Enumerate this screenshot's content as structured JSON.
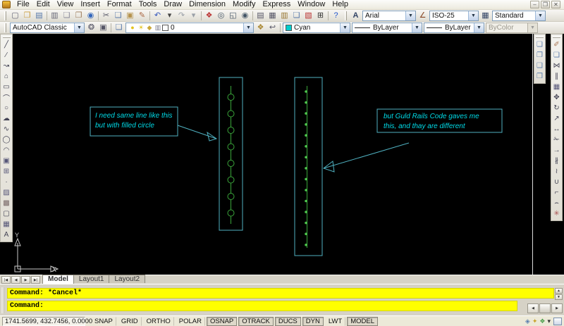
{
  "menu": {
    "items": [
      {
        "n": "menu-file",
        "t": "File"
      },
      {
        "n": "menu-edit",
        "t": "Edit"
      },
      {
        "n": "menu-view",
        "t": "View"
      },
      {
        "n": "menu-insert",
        "t": "Insert"
      },
      {
        "n": "menu-format",
        "t": "Format"
      },
      {
        "n": "menu-tools",
        "t": "Tools"
      },
      {
        "n": "menu-draw",
        "t": "Draw"
      },
      {
        "n": "menu-dimension",
        "t": "Dimension"
      },
      {
        "n": "menu-modify",
        "t": "Modify"
      },
      {
        "n": "menu-express",
        "t": "Express"
      },
      {
        "n": "menu-window",
        "t": "Window"
      },
      {
        "n": "menu-help",
        "t": "Help"
      }
    ]
  },
  "window_controls": [
    {
      "n": "minimize-button",
      "t": "–"
    },
    {
      "n": "restore-button",
      "t": "❐"
    },
    {
      "n": "close-button",
      "t": "✕"
    }
  ],
  "standard_toolbar": {
    "icons": [
      {
        "n": "new-icon",
        "t": "▢",
        "c": "#667"
      },
      {
        "n": "open-icon",
        "t": "❒",
        "c": "#c89a3a"
      },
      {
        "n": "save-icon",
        "t": "▤",
        "c": "#5577aa"
      },
      {
        "sep": true
      },
      {
        "n": "plot-icon",
        "t": "▥",
        "c": "#667"
      },
      {
        "n": "plot-preview-icon",
        "t": "❏",
        "c": "#889"
      },
      {
        "n": "publish-icon",
        "t": "❐",
        "c": "#997755"
      },
      {
        "n": "web-icon",
        "t": "◉",
        "c": "#3366bb"
      },
      {
        "sep": true
      },
      {
        "n": "cut-icon",
        "t": "✂",
        "c": "#556"
      },
      {
        "n": "copy-icon",
        "t": "❑",
        "c": "#5577aa"
      },
      {
        "n": "paste-icon",
        "t": "▣",
        "c": "#b5924c"
      },
      {
        "n": "match-properties-icon",
        "t": "✎",
        "c": "#aa6644"
      },
      {
        "sep": true
      },
      {
        "n": "undo-icon",
        "t": "↶",
        "c": "#3355bb"
      },
      {
        "n": "undo-dropdown-arrow",
        "t": "▾",
        "c": "#444"
      },
      {
        "n": "redo-icon",
        "t": "↷",
        "c": "#9aa0a8"
      },
      {
        "n": "redo-dropdown-arrow",
        "t": "▾",
        "c": "#9aa0a8"
      },
      {
        "sep": true
      },
      {
        "n": "pan-icon",
        "t": "❖",
        "c": "#bb3333"
      },
      {
        "n": "zoom-realtime-icon",
        "t": "◎",
        "c": "#445566"
      },
      {
        "n": "zoom-window-icon",
        "t": "◱",
        "c": "#445566"
      },
      {
        "n": "zoom-previous-icon",
        "t": "◉",
        "c": "#445566"
      },
      {
        "sep": true
      },
      {
        "n": "properties-icon",
        "t": "▤",
        "c": "#556"
      },
      {
        "n": "designcenter-icon",
        "t": "▦",
        "c": "#556"
      },
      {
        "n": "tool-palettes-icon",
        "t": "▥",
        "c": "#997733"
      },
      {
        "n": "sheet-set-icon",
        "t": "❏",
        "c": "#5577aa"
      },
      {
        "n": "markup-set-icon",
        "t": "▧",
        "c": "#bb3333"
      },
      {
        "n": "quickcalc-icon",
        "t": "⊞",
        "c": "#333"
      },
      {
        "sep": true
      },
      {
        "n": "help-icon",
        "t": "?",
        "c": "#2255cc"
      }
    ]
  },
  "styles_toolbar": {
    "text_style_icon": {
      "n": "text-style-icon",
      "t": "A",
      "c": "#334466"
    },
    "text_style": "Arial",
    "dim_style_icon": {
      "n": "dim-style-icon",
      "t": "∠",
      "c": "#884422"
    },
    "dim_style": "ISO-25",
    "table_style_icon": {
      "n": "table-style-icon",
      "t": "▦",
      "c": "#334466"
    },
    "table_style": "Standard"
  },
  "workspace_toolbar": {
    "value": "AutoCAD Classic",
    "icons": [
      {
        "n": "workspace-settings-icon",
        "t": "❂",
        "c": "#556"
      },
      {
        "n": "my-workspace-icon",
        "t": "▣",
        "c": "#556"
      }
    ]
  },
  "layers_toolbar": {
    "manager_icon": {
      "n": "layer-properties-manager-icon",
      "t": "❏",
      "c": "#5577aa"
    },
    "combo_icons": [
      {
        "n": "layer-on-icon",
        "t": "●",
        "c": "#e3c31c"
      },
      {
        "n": "layer-freeze-icon",
        "t": "☀",
        "c": "#e3c31c"
      },
      {
        "n": "layer-lock-icon",
        "t": "◆",
        "c": "#caa83a"
      },
      {
        "n": "layer-plot-icon",
        "t": "▥",
        "c": "#778"
      }
    ],
    "current_layer": "0",
    "layer_color_hex": "#ffffff",
    "right_icons": [
      {
        "n": "make-object-layer-current-icon",
        "t": "❖",
        "c": "#aa8833"
      },
      {
        "n": "layer-previous-icon",
        "t": "↩",
        "c": "#556"
      }
    ]
  },
  "properties_toolbar": {
    "color": "Cyan",
    "color_swatch_hex": "#00cccc",
    "linetype": "ByLayer",
    "lineweight": "ByLayer",
    "plot_style": "ByColor"
  },
  "draw_toolbar": {
    "icons": [
      {
        "n": "line-icon",
        "t": "╱",
        "c": "#445"
      },
      {
        "n": "construction-line-icon",
        "t": "∕",
        "c": "#445"
      },
      {
        "n": "polyline-icon",
        "t": "↝",
        "c": "#445"
      },
      {
        "n": "polygon-icon",
        "t": "⌂",
        "c": "#445"
      },
      {
        "n": "rectangle-icon",
        "t": "▭",
        "c": "#445"
      },
      {
        "n": "arc-icon",
        "t": "⌒",
        "c": "#445"
      },
      {
        "n": "circle-icon",
        "t": "○",
        "c": "#445"
      },
      {
        "n": "revcloud-icon",
        "t": "☁",
        "c": "#445"
      },
      {
        "n": "spline-icon",
        "t": "∿",
        "c": "#445"
      },
      {
        "n": "ellipse-icon",
        "t": "◯",
        "c": "#445"
      },
      {
        "n": "ellipse-arc-icon",
        "t": "◠",
        "c": "#445"
      },
      {
        "n": "insert-block-icon",
        "t": "▣",
        "c": "#557"
      },
      {
        "n": "make-block-icon",
        "t": "⊞",
        "c": "#557"
      },
      {
        "n": "point-icon",
        "t": "∙",
        "c": "#445"
      },
      {
        "n": "hatch-icon",
        "t": "▨",
        "c": "#557"
      },
      {
        "n": "gradient-icon",
        "t": "▩",
        "c": "#766"
      },
      {
        "n": "region-icon",
        "t": "▢",
        "c": "#445"
      },
      {
        "n": "table-icon",
        "t": "▦",
        "c": "#557"
      },
      {
        "n": "mtext-icon",
        "t": "A",
        "c": "#445"
      }
    ]
  },
  "draworder_toolbar": {
    "icons": [
      {
        "n": "bring-to-front-icon",
        "t": "❏",
        "c": "#5578aa"
      },
      {
        "n": "send-to-back-icon",
        "t": "❐",
        "c": "#5578aa"
      },
      {
        "n": "bring-above-icon",
        "t": "❑",
        "c": "#5578aa"
      },
      {
        "n": "send-under-icon",
        "t": "❒",
        "c": "#5578aa"
      }
    ]
  },
  "modify_toolbar": {
    "icons": [
      {
        "n": "erase-icon",
        "t": "✐",
        "c": "#aa7755"
      },
      {
        "n": "copy-object-icon",
        "t": "❏",
        "c": "#5577aa"
      },
      {
        "n": "mirror-icon",
        "t": "⋈",
        "c": "#445"
      },
      {
        "n": "offset-icon",
        "t": "∥",
        "c": "#445"
      },
      {
        "n": "array-icon",
        "t": "▦",
        "c": "#557"
      },
      {
        "n": "move-icon",
        "t": "✥",
        "c": "#445"
      },
      {
        "n": "rotate-icon",
        "t": "↻",
        "c": "#445"
      },
      {
        "n": "scale-icon",
        "t": "↗",
        "c": "#445"
      },
      {
        "n": "stretch-icon",
        "t": "↔",
        "c": "#445"
      },
      {
        "n": "trim-icon",
        "t": "✁",
        "c": "#445"
      },
      {
        "n": "extend-icon",
        "t": "→",
        "c": "#445"
      },
      {
        "n": "break-at-point-icon",
        "t": "∦",
        "c": "#445"
      },
      {
        "n": "break-icon",
        "t": "≀",
        "c": "#445"
      },
      {
        "n": "join-icon",
        "t": "∪",
        "c": "#445"
      },
      {
        "n": "chamfer-icon",
        "t": "⌐",
        "c": "#445"
      },
      {
        "n": "fillet-icon",
        "t": "⌢",
        "c": "#445"
      },
      {
        "n": "explode-icon",
        "t": "✳",
        "c": "#a55"
      }
    ]
  },
  "canvas": {
    "annotation1": {
      "line1": "I need same line like this",
      "line2": "but with filled circle"
    },
    "annotation2": {
      "line1": "but Guld Rails Code gaves me",
      "line2": "this, and thay are different"
    },
    "ucs": {
      "x": "X",
      "y": "Y"
    },
    "colors": {
      "entity_cyan": "#4fb0c0",
      "entity_green": "#3aa53a",
      "dot_green": "#4cc24c",
      "text_cyan": "#00dbe8",
      "background": "#000000"
    }
  },
  "tabs": {
    "nav": [
      {
        "n": "tab-first-button",
        "t": "|◀"
      },
      {
        "n": "tab-prev-button",
        "t": "◀"
      },
      {
        "n": "tab-next-button",
        "t": "▶"
      },
      {
        "n": "tab-last-button",
        "t": "▶|"
      }
    ],
    "items": [
      {
        "n": "tab-model",
        "t": "Model",
        "active": true
      },
      {
        "n": "tab-layout1",
        "t": "Layout1"
      },
      {
        "n": "tab-layout2",
        "t": "Layout2"
      }
    ]
  },
  "command": {
    "history_line": "Command: *Cancel*",
    "prompt_line": "Command:"
  },
  "status": {
    "coordinates": "1741.5699, 432.7456, 0.0000",
    "toggles": [
      {
        "n": "toggle-snap",
        "t": "SNAP"
      },
      {
        "n": "toggle-grid",
        "t": "GRID"
      },
      {
        "n": "toggle-ortho",
        "t": "ORTHO"
      },
      {
        "n": "toggle-polar",
        "t": "POLAR"
      },
      {
        "n": "toggle-osnap",
        "t": "OSNAP",
        "pressed": true
      },
      {
        "n": "toggle-otrack",
        "t": "OTRACK",
        "pressed": true
      },
      {
        "n": "toggle-ducs",
        "t": "DUCS",
        "pressed": true
      },
      {
        "n": "toggle-dyn",
        "t": "DYN",
        "pressed": true
      },
      {
        "n": "toggle-lwt",
        "t": "LWT"
      },
      {
        "n": "toggle-model",
        "t": "MODEL",
        "pressed": true
      }
    ],
    "tray_icons": [
      {
        "n": "annotation-visibility-icon",
        "t": "◈",
        "c": "#5a7fae"
      },
      {
        "n": "auto-scale-icon",
        "t": "✦",
        "c": "#c8a128"
      },
      {
        "n": "toolbar-lock-icon",
        "t": "❖",
        "c": "#4a9e4a"
      },
      {
        "n": "tray-menu-arrow",
        "t": "▾",
        "c": "#333333"
      }
    ]
  }
}
